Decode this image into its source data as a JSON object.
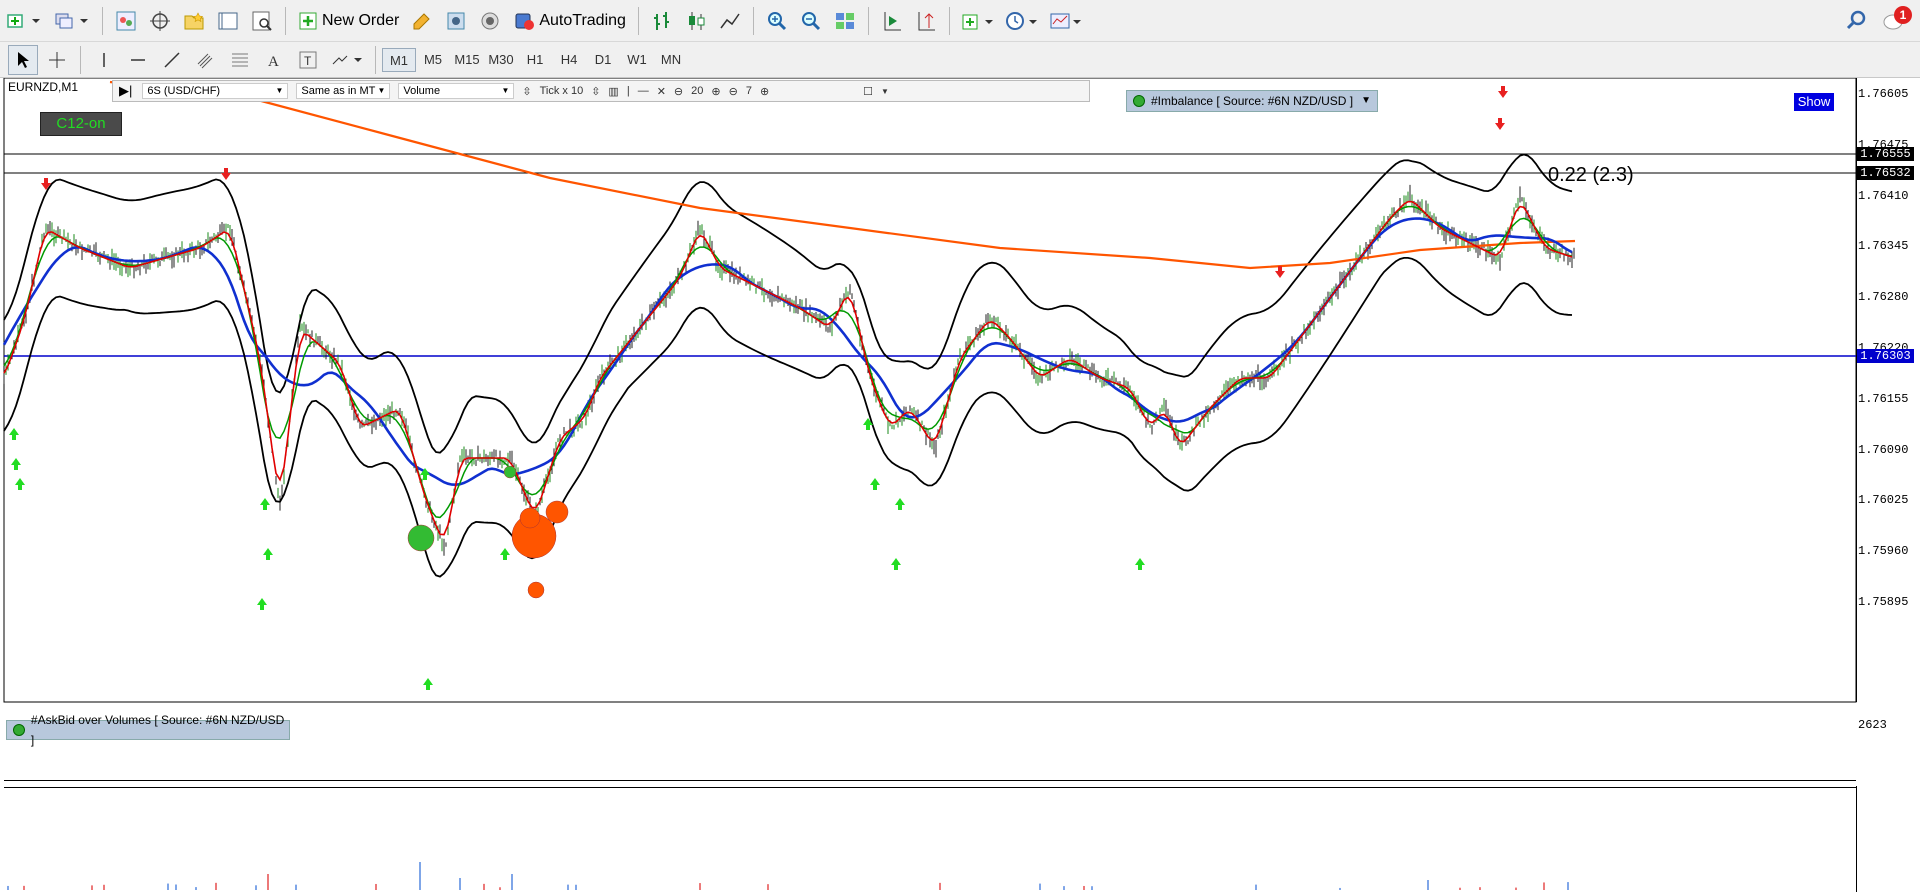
{
  "toolbar1": {
    "new_order_label": "New Order",
    "autotrading_label": "AutoTrading",
    "notification_count": "1"
  },
  "toolbar2": {
    "timeframes": [
      "M1",
      "M5",
      "M15",
      "M30",
      "H1",
      "H4",
      "D1",
      "W1",
      "MN"
    ],
    "active_timeframe": "M1"
  },
  "chart": {
    "symbol": "EURNZD,M1",
    "strip": {
      "instrument": "6S (USD/CHF)",
      "mode": "Same as in MT",
      "indicator": "Volume",
      "tick": "Tick x 10",
      "zoom_value": "20",
      "depth_value": "7"
    },
    "c12_label": "C12-on",
    "imbalance_label": "#Imbalance [ Source: #6N NZD/USD ]",
    "show_label": "Show",
    "annotation": "0.22 (2.3)",
    "price_ticks": [
      "1.76605",
      "1.76475",
      "1.76410",
      "1.76345",
      "1.76280",
      "1.76220",
      "1.76155",
      "1.76090",
      "1.76025",
      "1.75960",
      "1.75895"
    ],
    "price_boxes": [
      {
        "value": "1.76555",
        "color": "#000000"
      },
      {
        "value": "1.76532",
        "color": "#000000"
      },
      {
        "value": "1.76303",
        "color": "#0000cc"
      }
    ],
    "colors": {
      "ma_fast": "#e00000",
      "ma_medium": "#009a00",
      "ma_slow": "#1030d0",
      "ma_long": "#ff5500",
      "bands": "#000000",
      "horizontal_line": "#0000cc"
    }
  },
  "volume_pane": {
    "label": "#AskBid over Volumes [ Source: #6N NZD/USD ]",
    "max_label": "2623"
  }
}
